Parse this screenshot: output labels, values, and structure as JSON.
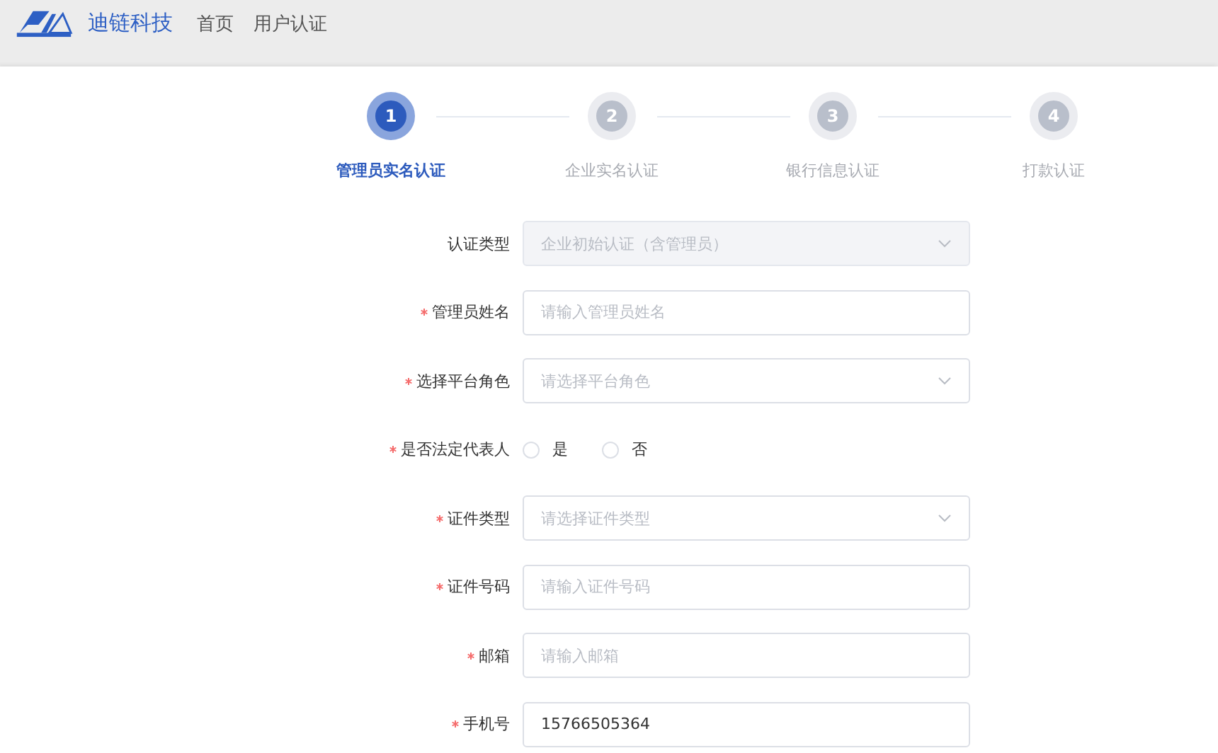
{
  "header": {
    "brand": "迪链科技",
    "nav": [
      {
        "label": "首页"
      },
      {
        "label": "用户认证"
      }
    ]
  },
  "steps": [
    {
      "number": "1",
      "label": "管理员实名认证",
      "active": true
    },
    {
      "number": "2",
      "label": "企业实名认证",
      "active": false
    },
    {
      "number": "3",
      "label": "银行信息认证",
      "active": false
    },
    {
      "number": "4",
      "label": "打款认证",
      "active": false
    }
  ],
  "form": [
    {
      "kind": "select",
      "label": "认证类型",
      "required": false,
      "disabled": true,
      "value": "企业初始认证（含管理员）"
    },
    {
      "kind": "input",
      "label": "管理员姓名",
      "required": true,
      "placeholder": "请输入管理员姓名"
    },
    {
      "kind": "select",
      "label": "选择平台角色",
      "required": true,
      "disabled": false,
      "placeholder": "请选择平台角色"
    },
    {
      "kind": "radio",
      "label": "是否法定代表人",
      "required": true,
      "options": [
        {
          "label": "是",
          "selected": false
        },
        {
          "label": "否",
          "selected": false
        }
      ]
    },
    {
      "kind": "select",
      "label": "证件类型",
      "required": true,
      "disabled": false,
      "placeholder": "请选择证件类型"
    },
    {
      "kind": "input",
      "label": "证件号码",
      "required": true,
      "placeholder": "请输入证件号码"
    },
    {
      "kind": "input",
      "label": "邮箱",
      "required": true,
      "placeholder": "请输入邮箱"
    },
    {
      "kind": "input",
      "label": "手机号",
      "required": true,
      "value": "15766505364"
    }
  ]
}
